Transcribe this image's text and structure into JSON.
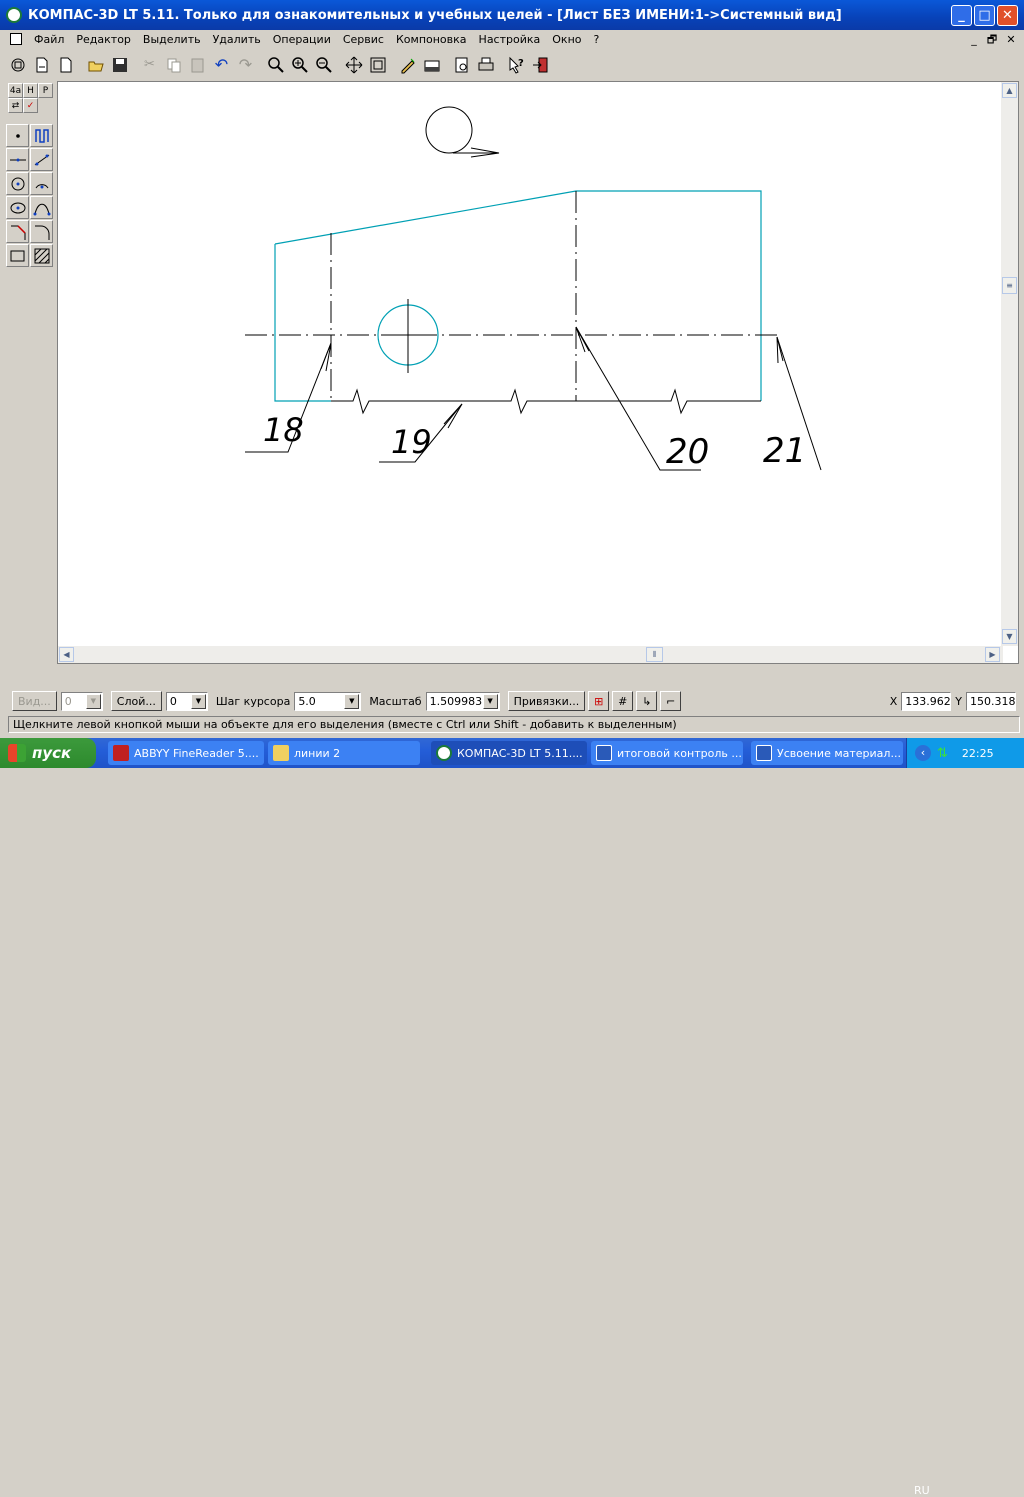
{
  "window": {
    "title": "КОМПАС-3D LT 5.11. Только для ознакомительных и учебных целей - [Лист БЕЗ ИМЕНИ:1->Системный вид]",
    "controls": {
      "minimize": "_",
      "maximize": "□",
      "close": "✕"
    }
  },
  "menu": {
    "items": [
      "Файл",
      "Редактор",
      "Выделить",
      "Удалить",
      "Операции",
      "Сервис",
      "Компоновка",
      "Настройка",
      "Окно",
      "?"
    ],
    "mdi_controls": [
      "_",
      "🗗",
      "✕"
    ]
  },
  "toolbar": {
    "buttons": [
      "new-sheet-icon",
      "new-fragment-icon",
      "new-document-icon",
      "open-icon",
      "save-icon",
      "cut-icon",
      "copy-icon",
      "paste-icon",
      "undo-icon",
      "redo-icon",
      "zoom-window-icon",
      "zoom-in-icon",
      "zoom-out-icon",
      "pan-icon",
      "show-all-icon",
      "redraw-icon",
      "layers-icon",
      "preview-icon",
      "print-icon",
      "help-icon",
      "exit-icon"
    ]
  },
  "left_panel": {
    "tabs": [
      "4a",
      "H",
      "P"
    ],
    "tools": [
      "point-icon",
      "auxiliary-line-icon",
      "segment-icon",
      "parallel-line-icon",
      "circle-icon",
      "arc-icon",
      "ellipse-icon",
      "spline-icon",
      "chamfer-icon",
      "fillet-icon",
      "rectangle-icon",
      "hatch-icon"
    ]
  },
  "drawing": {
    "callout_labels": [
      "18",
      "19",
      "20",
      "21"
    ],
    "colors": {
      "contour": "#00a0b4",
      "lines": "#000000",
      "background": "#ffffff"
    }
  },
  "statusbar": {
    "view_btn": "Вид...",
    "view_value": "0",
    "layer_btn": "Слой...",
    "layer_value": "0",
    "step_label": "Шаг курсора",
    "step_value": "5.0",
    "scale_label": "Масштаб",
    "scale_value": "1.509983",
    "snap_btn": "Привязки...",
    "x_label": "X",
    "x_value": "133.962",
    "y_label": "Y",
    "y_value": "150.318"
  },
  "hint": "Щелкните левой кнопкой мыши на объекте для его выделения (вместе с Ctrl или Shift - добавить к выделенным)",
  "taskbar": {
    "start": "пуск",
    "tasks": [
      "ABBYY FineReader 5....",
      "линии 2",
      "КОМПАС-3D LT 5.11....",
      "итоговой контроль ...",
      "Усвоение материал..."
    ],
    "lang": "RU",
    "clock": "22:25"
  }
}
